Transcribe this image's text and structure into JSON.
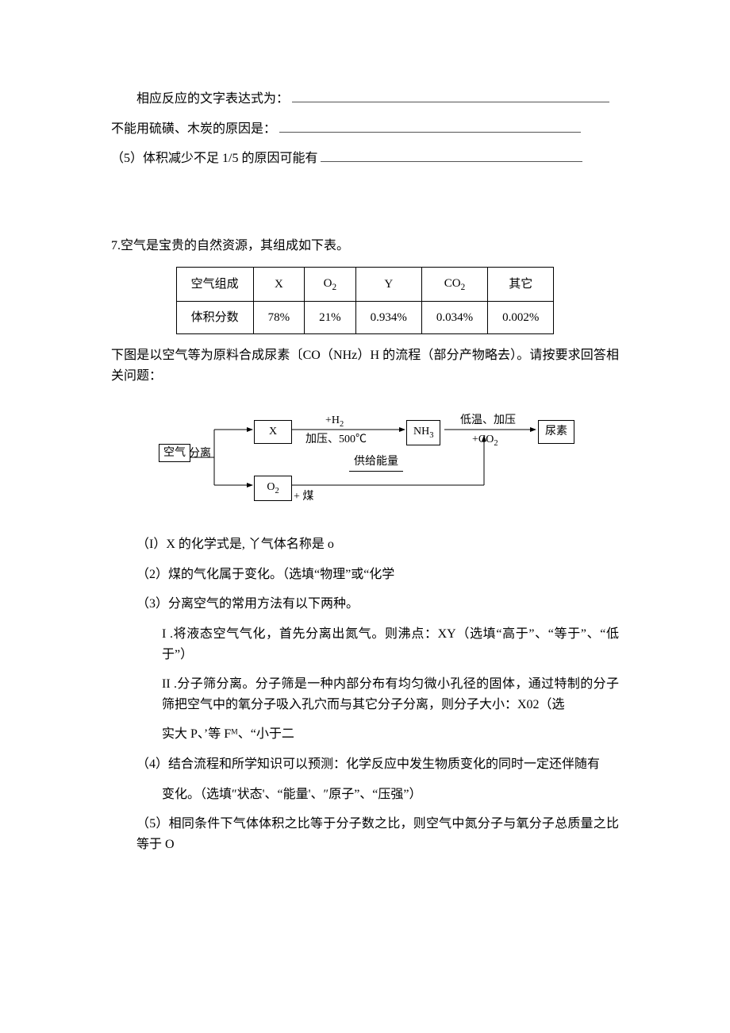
{
  "q6_tail": {
    "line1_prefix": "相应反应的文字表达式为：",
    "line2_prefix": "不能用硫磺、木炭的原因是：",
    "q5_prefix": "（5）体积减少不足 1/5 的原因可能有"
  },
  "q7": {
    "intro": "7.空气是宝贵的自然资源，其组成如下表。",
    "table": {
      "header": [
        "空气组成",
        "X",
        "O2",
        "Y",
        "CO2",
        "其它"
      ],
      "row2h": "体积分数",
      "values": [
        "78%",
        "21%",
        "0.934%",
        "0.034%",
        "0.002%"
      ]
    },
    "caption": "下图是以空气等为原料合成尿素〔CO（NHz）H 的流程（部分产物略去）。请按要求回答相关问题：",
    "diagram": {
      "air": "空气",
      "split": "分离",
      "X": "X",
      "O2": "O2",
      "coal": "+ 煤",
      "h2": "+H2",
      "cond1": "加压、500℃",
      "supply": "供给能量",
      "nh3": "NH3",
      "cond2": "低温、加压",
      "co2": "+CO2",
      "urea": "尿素"
    },
    "parts": {
      "p1": "（I）X 的化学式是, 丫气体名称是 o",
      "p2": "（2）煤的气化属于变化。（选填“物理”或“化学",
      "p3": "（3）分离空气的常用方法有以下两种。",
      "p3i": "I .将液态空气气化，首先分离出氮气。则沸点：XY（选填“高于”、“等于”、“低于”）",
      "p3ii_a": "II .分子筛分离。分子筛是一种内部分布有均匀微小孔径的固体，通过特制的分子筛把空气中的氧分子吸入孔穴而与其它分子分离，则分子大小：X02（选",
      "p3ii_b": "实大 P、’等 Fᴹ、“小于二",
      "p4_a": "（4）结合流程和所学知识可以预测：化学反应中发生物质变化的同时一定还伴随有",
      "p4_b": "变化。（选填″状态'、“能量'、″原子”、“压强”）",
      "p5": "（5）相同条件下气体体积之比等于分子数之比，则空气中氮分子与氧分子总质量之比等于 O"
    }
  },
  "chart_data": {
    "type": "table",
    "title": "空气组成体积分数",
    "categories": [
      "X",
      "O2",
      "Y",
      "CO2",
      "其它"
    ],
    "values": [
      78,
      21,
      0.934,
      0.034,
      0.002
    ],
    "ylabel": "体积分数 (%)"
  }
}
